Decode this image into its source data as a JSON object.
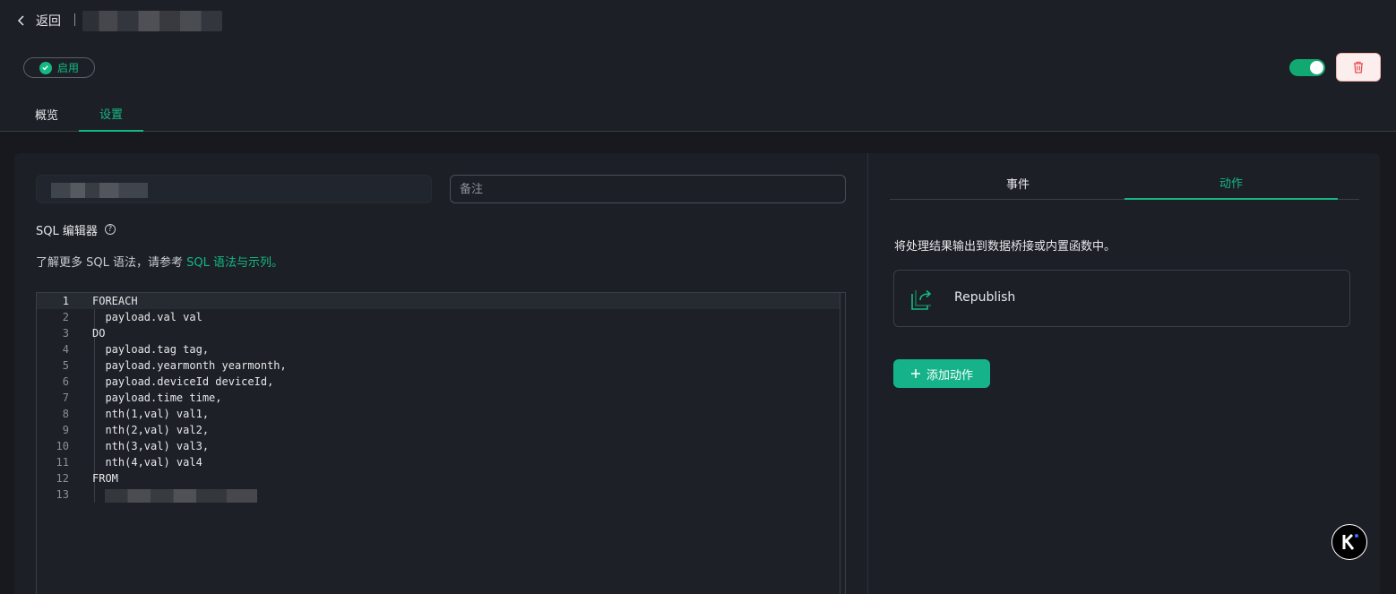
{
  "header": {
    "back_label": "返回",
    "status_label": "启用",
    "accent": "#14b982",
    "tabs": [
      {
        "label": "概览",
        "active": false
      },
      {
        "label": "设置",
        "active": true
      }
    ]
  },
  "form": {
    "remark_placeholder": "备注",
    "sql_editor_label": "SQL 编辑器",
    "sql_hint_prefix": "了解更多 SQL 语法，请参考 ",
    "sql_hint_link": "SQL 语法与示列。"
  },
  "editor": {
    "lines": [
      {
        "n": "1",
        "text": "FOREACH"
      },
      {
        "n": "2",
        "text": "  payload.val val"
      },
      {
        "n": "3",
        "text": "DO"
      },
      {
        "n": "4",
        "text": "  payload.tag tag,"
      },
      {
        "n": "5",
        "text": "  payload.yearmonth yearmonth,"
      },
      {
        "n": "6",
        "text": "  payload.deviceId deviceId,"
      },
      {
        "n": "7",
        "text": "  payload.time time,"
      },
      {
        "n": "8",
        "text": "  nth(1,val) val1,"
      },
      {
        "n": "9",
        "text": "  nth(2,val) val2,"
      },
      {
        "n": "10",
        "text": "  nth(3,val) val3,"
      },
      {
        "n": "11",
        "text": "  nth(4,val) val4"
      },
      {
        "n": "12",
        "text": "FROM"
      },
      {
        "n": "13",
        "text": ""
      }
    ]
  },
  "right_panel": {
    "tabs": [
      {
        "label": "事件",
        "active": false
      },
      {
        "label": "动作",
        "active": true
      }
    ],
    "description": "将处理结果输出到数据桥接或内置函数中。",
    "action_name": "Republish",
    "add_action_label": "添加动作"
  }
}
